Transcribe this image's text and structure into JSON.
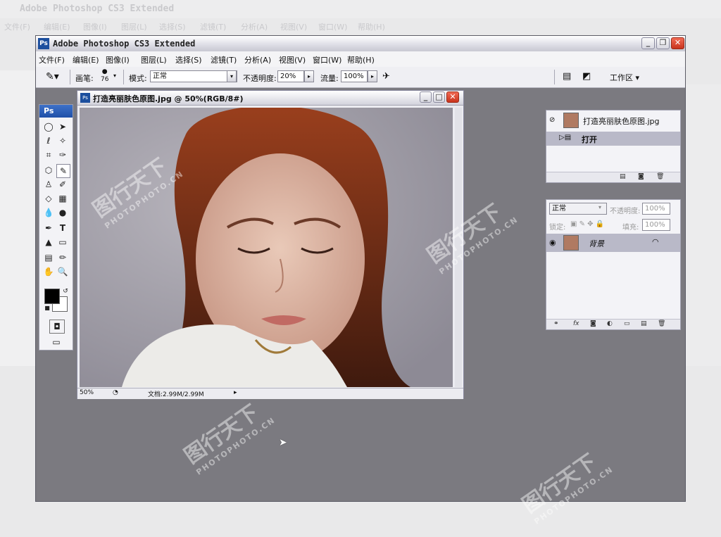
{
  "background_app": {
    "title": "Adobe Photoshop CS3 Extended",
    "menu": [
      "文件(F)",
      "编辑(E)",
      "图像(I)",
      "图层(L)",
      "选择(S)",
      "滤镜(T)",
      "分析(A)",
      "视图(V)",
      "窗口(W)",
      "帮助(H)"
    ]
  },
  "window": {
    "app_icon": "Ps",
    "title": "Adobe Photoshop CS3 Extended",
    "minimize": "_",
    "restore": "❐",
    "close": "✕"
  },
  "menu": [
    "文件(F)",
    "编辑(E)",
    "图像(I)",
    "图层(L)",
    "选择(S)",
    "滤镜(T)",
    "分析(A)",
    "视图(V)",
    "窗口(W)",
    "帮助(H)"
  ],
  "options_bar": {
    "brush_label": "画笔:",
    "brush_size": "76",
    "mode_label": "模式:",
    "mode_value": "正常",
    "opacity_label": "不透明度:",
    "opacity_value": "20%",
    "flow_label": "流量:",
    "flow_value": "100%",
    "workspace_label": "工作区 ▾"
  },
  "toolbox": {
    "logo": "Ps"
  },
  "document": {
    "icon": "Ps",
    "title": "打造亮丽肤色原图.jpg @ 50%(RGB/8#)",
    "zoom": "50%",
    "doc_size": "文档:2.99M/2.99M"
  },
  "history_panel": {
    "snapshot_label": "打造亮丽肤色原图.jpg",
    "step_label": "打开"
  },
  "layers_panel": {
    "blend_mode": "正常",
    "opacity_label": "不透明度:",
    "opacity_value": "100%",
    "lock_label": "锁定:",
    "fill_label": "填充:",
    "fill_value": "100%",
    "layer_name": "背景"
  },
  "watermarks": [
    "图行天下",
    "PHOTOPHOTO.CN"
  ]
}
